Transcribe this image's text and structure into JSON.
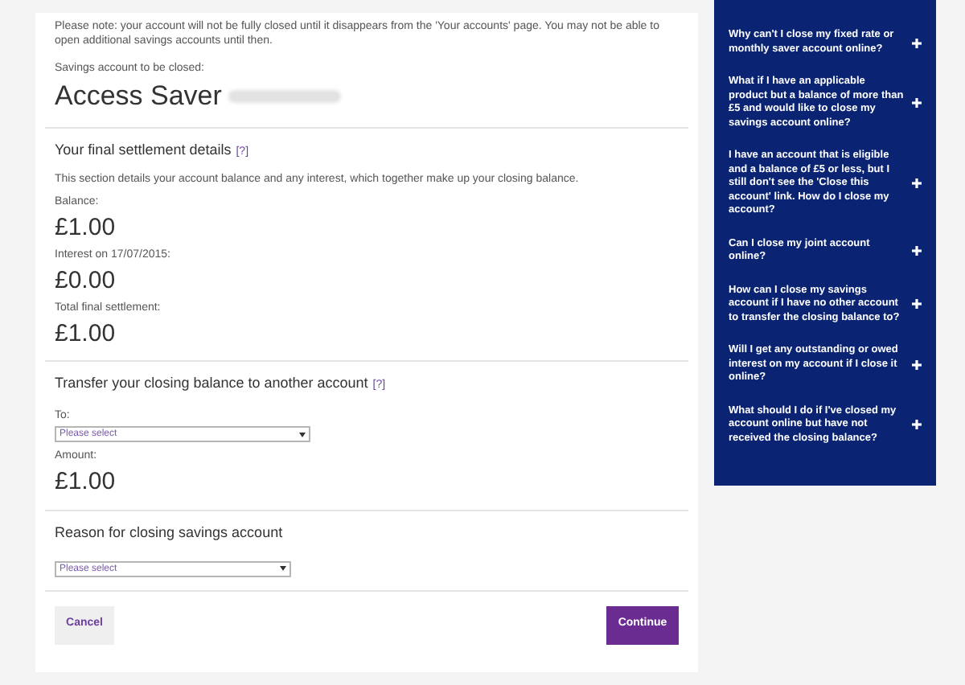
{
  "notice": "Please note: your account will not be fully closed until it disappears from the 'Your accounts' page. You may not be able to open additional savings accounts until then.",
  "account": {
    "label": "Savings account to be closed:",
    "name": "Access Saver"
  },
  "settlement": {
    "heading": "Your final settlement details",
    "help": "[?]",
    "description": "This section details your account balance and any interest, which together make up your closing balance.",
    "items": [
      {
        "label": "Balance:",
        "value": "£1.00"
      },
      {
        "label": "Interest on 17/07/2015:",
        "value": "£0.00"
      },
      {
        "label": "Total final settlement:",
        "value": "£1.00"
      }
    ]
  },
  "transfer": {
    "heading": "Transfer your closing balance to another account",
    "help": "[?]",
    "to_label": "To:",
    "to_placeholder": "Please select",
    "amount_label": "Amount:",
    "amount": "£1.00"
  },
  "reason": {
    "heading": "Reason for closing savings account",
    "placeholder": "Please select"
  },
  "buttons": {
    "cancel": "Cancel",
    "continue": "Continue"
  },
  "faq": [
    {
      "question": "Why can't I close my fixed rate or monthly saver account online?",
      "expanded": false
    },
    {
      "question": "What if I have an applicable product but a balance of more than £5 and would like to close my savings account online?",
      "expanded": false
    },
    {
      "question": "I have an account that is eligible and a balance of £5 or less, but I still don't see the 'Close this account' link. How do I close my account?",
      "expanded": false
    },
    {
      "question": "Can I close my joint account online?",
      "expanded": false
    },
    {
      "question": "How can I close my savings account if I have no other account to transfer the closing balance to?",
      "expanded": false
    },
    {
      "question": "Will I get any outstanding or owed interest on my account if I close it online?",
      "expanded": false
    },
    {
      "question": "What should I do if I've closed my account online but have not received the closing balance?",
      "expanded": false
    }
  ]
}
